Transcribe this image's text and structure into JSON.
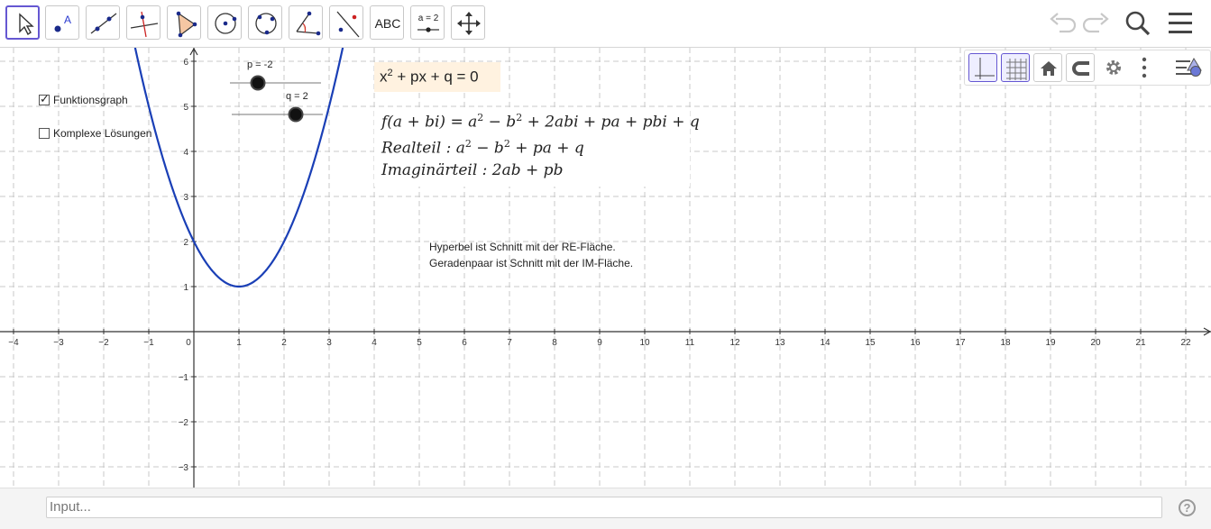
{
  "toolbar": {
    "tools": [
      "move-tool",
      "point-tool",
      "line-tool",
      "perpendicular-line-tool",
      "polygon-tool",
      "circle-center-point-tool",
      "circle-three-points-tool",
      "angle-tool",
      "reflect-tool",
      "text-tool",
      "slider-tool",
      "move-graphics-view-tool"
    ],
    "text_tool_label": "ABC",
    "slider_tool_label": "a = 2",
    "point_tool_label": "A"
  },
  "checkboxes": [
    {
      "label": "Funktionsgraph",
      "checked": true
    },
    {
      "label": "Komplexe Lösungen",
      "checked": false
    }
  ],
  "sliders": [
    {
      "label": "p = -2",
      "value": -2
    },
    {
      "label": "q = 2",
      "value": 2
    }
  ],
  "equation_box": {
    "lhs": "x",
    "exp": "2",
    "rest": " + px + q = 0"
  },
  "math_text": {
    "line1": {
      "a": "f(a + bi) = a",
      "b": " − b",
      "c": " + 2abi + pa + pbi + q"
    },
    "line2": {
      "a": "Realteil : a",
      "b": " − b",
      "c": " + pa + q"
    },
    "line3": "Imaginärteil : 2ab + pb",
    "sq": "2"
  },
  "notes": {
    "line1": "Hyperbel ist Schnitt mit der RE-Fläche.",
    "line2": "Geradenpaar ist Schnitt mit der IM-Fläche."
  },
  "axes": {
    "x_ticks": [
      "−4",
      "−3",
      "−2",
      "−1",
      "0",
      "1",
      "2",
      "3",
      "4",
      "5",
      "6",
      "7",
      "8",
      "9",
      "10",
      "11",
      "12",
      "13",
      "14",
      "15",
      "16",
      "17",
      "18",
      "19",
      "20",
      "21",
      "22"
    ],
    "y_ticks": [
      "6",
      "5",
      "4",
      "3",
      "2",
      "1",
      "−1",
      "−2",
      "−3"
    ]
  },
  "chart_data": {
    "type": "line",
    "function": "f(x) = x^2 + px + q",
    "params": {
      "p": -2,
      "q": 2
    },
    "series": [
      {
        "x": [
          -1.3,
          -1,
          -0.5,
          0,
          0.5,
          1,
          1.5,
          2,
          2.5,
          3,
          3.3
        ],
        "y": [
          6.29,
          5,
          3.25,
          2,
          1.25,
          1,
          1.25,
          2,
          3.25,
          5,
          6.29
        ]
      }
    ],
    "xlim": [
      -4.3,
      22.5
    ],
    "ylim": [
      -3.4,
      6.3
    ],
    "grid": true,
    "color": "#1a3fb6"
  },
  "input": {
    "placeholder": "Input..."
  },
  "help": {
    "icon_text": "?"
  },
  "colors": {
    "accent": "#6557d2",
    "curve": "#1a3fb6",
    "equation_bg": "#fff2e0"
  }
}
